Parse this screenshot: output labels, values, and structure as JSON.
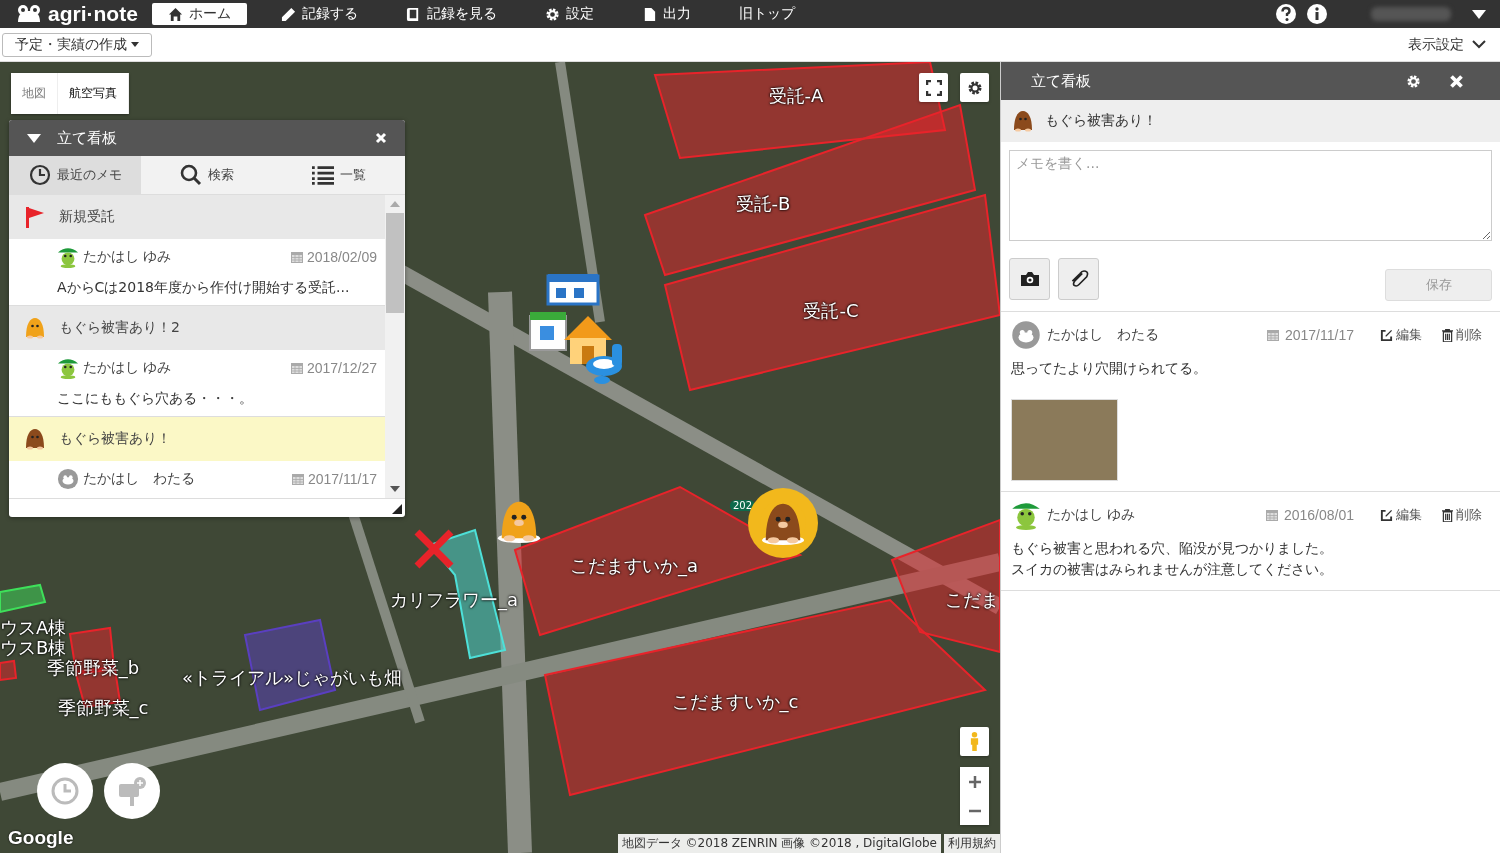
{
  "topbar": {
    "logo": "agri·note",
    "nav": [
      {
        "label": "ホーム",
        "selected": true
      },
      {
        "label": "記録する",
        "selected": false
      },
      {
        "label": "記録を見る",
        "selected": false
      },
      {
        "label": "設定",
        "selected": false
      },
      {
        "label": "出力",
        "selected": false
      },
      {
        "label": "旧トップ",
        "selected": false
      }
    ]
  },
  "subbar": {
    "plan_button": "予定・実績の作成",
    "view_settings": "表示設定"
  },
  "map": {
    "type_buttons": [
      {
        "label": "地図",
        "selected": false
      },
      {
        "label": "航空写真",
        "selected": true
      }
    ],
    "fields": [
      {
        "label": "受託-A",
        "color": "#e8232a"
      },
      {
        "label": "受託-B",
        "color": "#e8232a"
      },
      {
        "label": "受託-C",
        "color": "#e8232a"
      },
      {
        "label": "こだますいか_a",
        "color": "#e8232a"
      },
      {
        "label": "カリフラワー_a",
        "color": "#4de0d8"
      },
      {
        "label": "こだま",
        "color": "#e8232a"
      },
      {
        "label": "ウスA棟",
        "color": "#3ee05a"
      },
      {
        "label": "ウスB棟",
        "color": "#e8232a"
      },
      {
        "label": "季節野菜_b",
        "color": "#e8232a"
      },
      {
        "label": "«トライアル»じゃがいも畑",
        "color": "#5a3fc0"
      },
      {
        "label": "季節野菜_c",
        "color": "#e8232a"
      },
      {
        "label": "こだますいか_c",
        "color": "#e8232a"
      }
    ],
    "markers": [
      {
        "kind": "facility",
        "selected": false
      },
      {
        "kind": "mole-orange",
        "selected": false
      },
      {
        "kind": "cross",
        "selected": false
      },
      {
        "kind": "mole-brown",
        "selected": true
      }
    ],
    "road_sign": "202",
    "logo": "Google",
    "attribution": "地図データ ©2018 ZENRIN 画像 ©2018 , DigitalGlobe",
    "terms": "利用規約"
  },
  "board_panel": {
    "title": "立て看板",
    "tabs": [
      {
        "label": "最近のメモ",
        "selected": true
      },
      {
        "label": "検索",
        "selected": false
      },
      {
        "label": "一覧",
        "selected": false
      }
    ],
    "groups": [
      {
        "title": "新規受託",
        "kind": "flag",
        "selected": false,
        "memos": [
          {
            "author": "たかはし ゆみ",
            "kind": "frog",
            "date": "2018/02/09",
            "text": "AからCは2018年度から作付け開始する受託..."
          }
        ]
      },
      {
        "title": "もぐら被害あり！2",
        "kind": "mole-orange",
        "selected": false,
        "memos": [
          {
            "author": "たかはし ゆみ",
            "kind": "frog",
            "date": "2017/12/27",
            "text": "ここにももぐら穴ある・・・。"
          }
        ]
      },
      {
        "title": "もぐら被害あり！",
        "kind": "mole-brown",
        "selected": true,
        "memos": [
          {
            "author": "たかはし　わたる",
            "kind": "grey",
            "date": "2017/11/17"
          }
        ]
      }
    ]
  },
  "detail_panel": {
    "title": "立て看板",
    "board": {
      "title": "もぐら被害あり！",
      "kind": "mole-brown"
    },
    "memo_placeholder": "メモを書く...",
    "save_button": "保存",
    "save_disabled": true,
    "comments": [
      {
        "author": "たかはし　わたる",
        "kind": "grey",
        "date": "2017/11/17",
        "edit": "編集",
        "delete": "削除",
        "lines": [
          "思ってたより穴開けられてる。"
        ],
        "photo": true
      },
      {
        "author": "たかはし ゆみ",
        "kind": "frog",
        "date": "2016/08/01",
        "edit": "編集",
        "delete": "削除",
        "lines": [
          "もぐら被害と思われる穴、陥没が見つかりました。",
          "スイカの被害はみられませんが注意してください。"
        ],
        "photo": false
      }
    ]
  }
}
